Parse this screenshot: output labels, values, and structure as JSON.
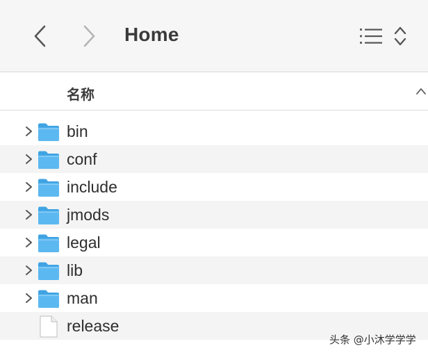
{
  "toolbar": {
    "title": "Home",
    "back_icon": "chevron-left-icon",
    "forward_icon": "chevron-right-icon",
    "view_icon": "list-view-icon",
    "sort_icon": "up-down-chevron-icon"
  },
  "columns": {
    "name_label": "名称",
    "sort_direction": "ascending"
  },
  "files": [
    {
      "name": "bin",
      "type": "folder"
    },
    {
      "name": "conf",
      "type": "folder"
    },
    {
      "name": "include",
      "type": "folder"
    },
    {
      "name": "jmods",
      "type": "folder"
    },
    {
      "name": "legal",
      "type": "folder"
    },
    {
      "name": "lib",
      "type": "folder"
    },
    {
      "name": "man",
      "type": "folder"
    },
    {
      "name": "release",
      "type": "file"
    }
  ],
  "watermark": "头条 @小沐学学学",
  "colors": {
    "folder": "#5cb8f0",
    "folder_dark": "#3fa3e3",
    "toolbar_bg": "#f6f6f6",
    "alt_row": "#f4f4f4"
  }
}
